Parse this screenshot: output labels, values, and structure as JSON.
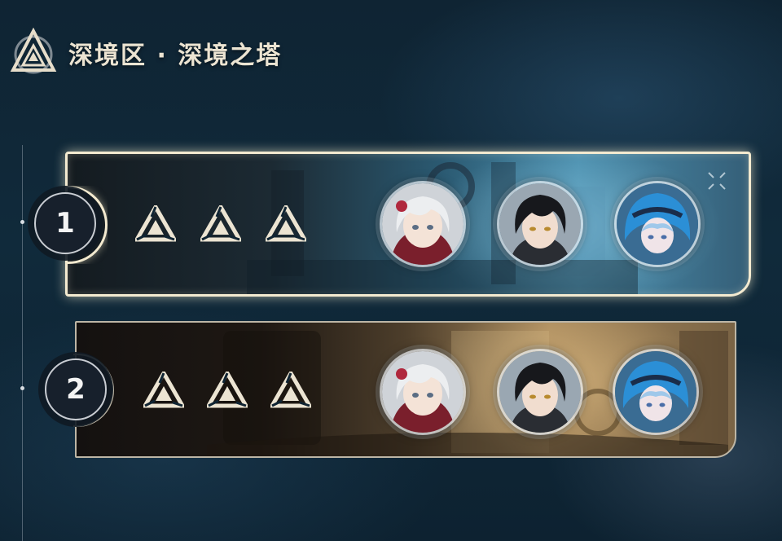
{
  "header": {
    "title": "深境区 · 深境之塔",
    "logo_icon": "abyss-triangle-emblem-icon"
  },
  "stages": [
    {
      "number": "1",
      "selected": true,
      "theme": "blue",
      "objective_icons": [
        "trinity-star-icon",
        "trinity-star-icon",
        "trinity-star-icon"
      ],
      "team": [
        "white-haired-girl-avatar",
        "black-haired-boy-avatar",
        "blue-hooded-girl-avatar"
      ]
    },
    {
      "number": "2",
      "selected": false,
      "theme": "gold",
      "objective_icons": [
        "trinity-star-icon",
        "trinity-star-icon",
        "trinity-star-icon"
      ],
      "team": [
        "white-haired-girl-avatar",
        "black-haired-boy-avatar",
        "blue-hooded-girl-avatar"
      ]
    }
  ],
  "colors": {
    "background": "#102a3b",
    "selected_border": "#f3ead0",
    "unselected_border": "#bdb6a6",
    "icon_fill": "#ece4d2"
  }
}
